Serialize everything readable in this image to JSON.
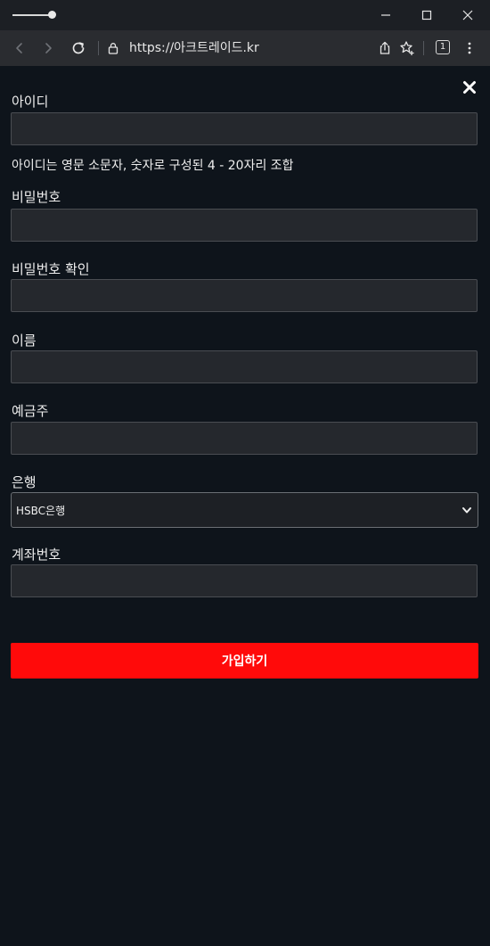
{
  "browser": {
    "url": "https://아크트레이드.kr",
    "tab_count": "1"
  },
  "form": {
    "username_label": "아이디",
    "username_hint": "아이디는 영문 소문자, 숫자로 구성된 4 - 20자리 조합",
    "password_label": "비밀번호",
    "password_confirm_label": "비밀번호 확인",
    "name_label": "이름",
    "depositor_label": "예금주",
    "bank_label": "은행",
    "bank_selected": "HSBC은행",
    "account_label": "계좌번호",
    "submit_label": "가입하기"
  },
  "colors": {
    "page_background": "#0e141b",
    "input_background": "#25282d",
    "submit_button": "#ff0a0a"
  },
  "icons": {
    "close": "close-icon",
    "back": "back-arrow-icon",
    "forward": "forward-arrow-icon",
    "reload": "reload-icon",
    "lock": "lock-icon",
    "share": "share-icon",
    "favorite": "star-add-icon",
    "menu": "more-vertical-icon"
  }
}
